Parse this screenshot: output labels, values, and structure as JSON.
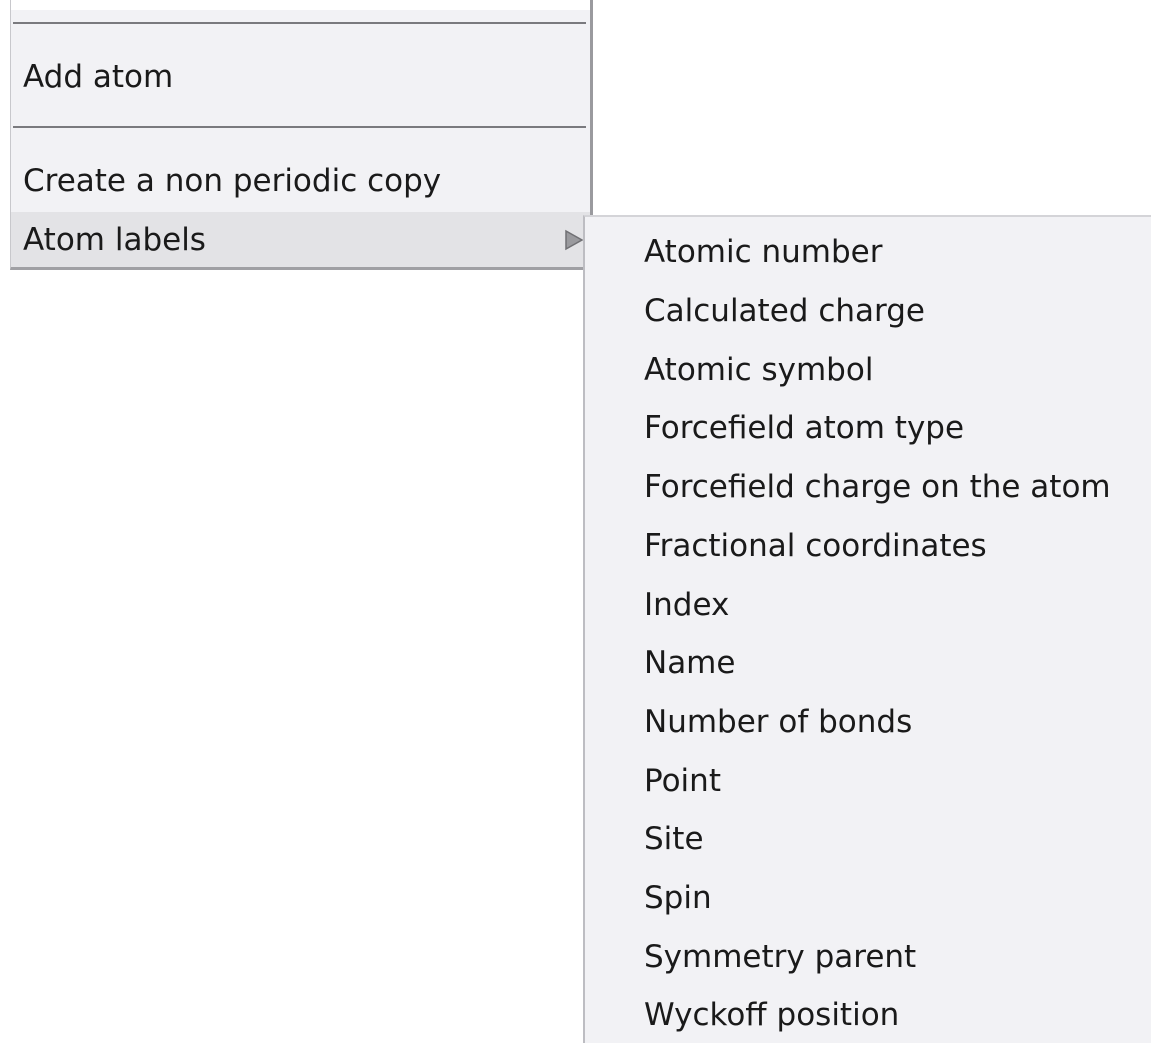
{
  "main_menu": {
    "items": [
      {
        "label": "Add atom"
      },
      {
        "label": "Create a non periodic copy"
      },
      {
        "label": "Atom labels"
      }
    ],
    "submenu_arrow_icon": "submenu-arrow-icon"
  },
  "submenu": {
    "items": [
      {
        "label": "Atomic number"
      },
      {
        "label": "Calculated charge"
      },
      {
        "label": "Atomic symbol"
      },
      {
        "label": "Forcefield atom type"
      },
      {
        "label": "Forcefield charge on the atom"
      },
      {
        "label": "Fractional coordinates"
      },
      {
        "label": "Index"
      },
      {
        "label": "Name"
      },
      {
        "label": "Number of bonds"
      },
      {
        "label": "Point"
      },
      {
        "label": "Site"
      },
      {
        "label": "Spin"
      },
      {
        "label": "Symmetry parent"
      },
      {
        "label": "Wyckoff position"
      }
    ]
  },
  "colors": {
    "menu_background": "#f2f2f5",
    "highlight_background": "#e3e3e6",
    "text": "#1a1a1a"
  }
}
